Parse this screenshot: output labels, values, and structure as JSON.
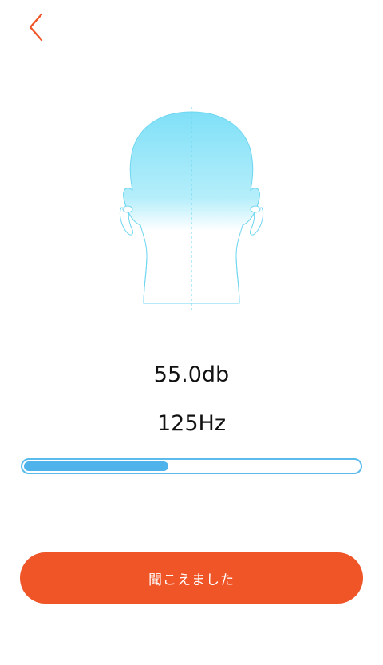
{
  "header": {
    "back_icon": "chevron-left-icon",
    "accent_color": "#ef5527"
  },
  "illustration": {
    "icon": "head-with-earbuds-icon",
    "color": "#6fd6f0"
  },
  "test": {
    "level": "55.0db",
    "frequency": "125Hz",
    "progress_fraction": 0.43,
    "progress_color": "#4eb3ea"
  },
  "actions": {
    "heard_label": "聞こえました",
    "heard_color": "#ef5527"
  }
}
